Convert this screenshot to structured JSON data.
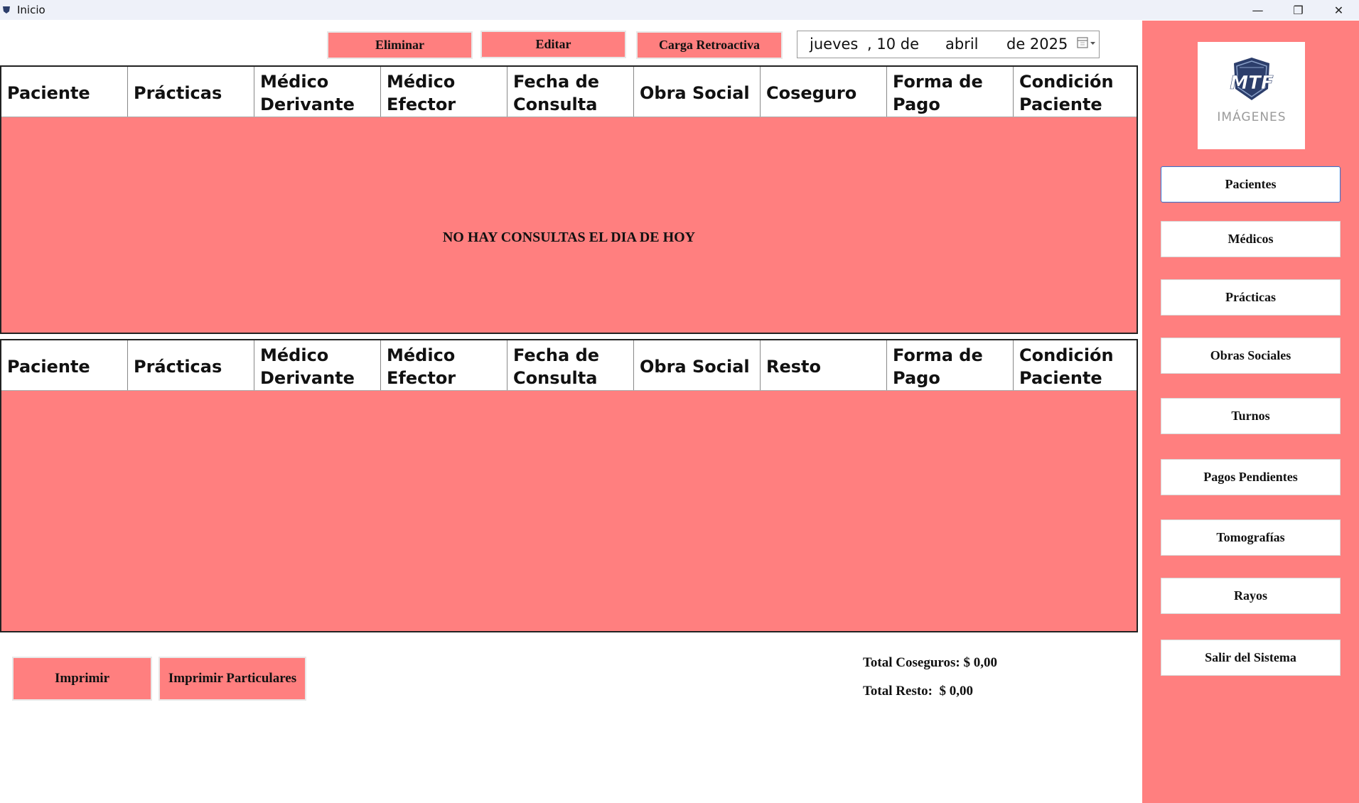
{
  "window": {
    "title": "Inicio",
    "controls": {
      "minimize": "—",
      "maximize": "❐",
      "close": "✕"
    }
  },
  "toolbar": {
    "eliminar_label": "Eliminar",
    "editar_label": "Editar",
    "carga_retroactiva_label": "Carga Retroactiva"
  },
  "date_picker": {
    "weekday": "jueves",
    "day": ", 10 de",
    "month": "abril",
    "year": "de 2025",
    "icon": "calendar-icon"
  },
  "consultas_table": {
    "columns": [
      "Paciente",
      "Prácticas",
      "Médico Derivante",
      "Médico Efector",
      "Fecha de Consulta",
      "Obra Social",
      "Coseguro",
      "Forma de Pago",
      "Condición Paciente"
    ],
    "empty_message": "NO HAY CONSULTAS EL DIA DE HOY",
    "rows": []
  },
  "particulares_table": {
    "columns": [
      "Paciente",
      "Prácticas",
      "Médico Derivante",
      "Médico Efector",
      "Fecha de Consulta",
      "Obra Social",
      "Resto",
      "Forma de Pago",
      "Condición Paciente"
    ],
    "rows": []
  },
  "bottom": {
    "imprimir_label": "Imprimir",
    "imprimir_particulares_label": "Imprimir Particulares",
    "total_coseguros": "Total Coseguros: $ 0,00",
    "total_resto": "Total Resto:  $ 0,00"
  },
  "sidebar": {
    "logo": {
      "brand": "MTF",
      "subtitle": "IMÁGENES"
    },
    "items": [
      {
        "label": "Pacientes",
        "active": true
      },
      {
        "label": "Médicos"
      },
      {
        "label": "Prácticas"
      },
      {
        "label": "Obras Sociales"
      },
      {
        "label": "Turnos"
      },
      {
        "label": "Pagos Pendientes"
      },
      {
        "label": "Tomografías"
      },
      {
        "label": "Rayos"
      },
      {
        "label": "Salir del Sistema"
      }
    ]
  },
  "colors": {
    "accent": "#ff7f7f",
    "logo_navy": "#2c3e6b",
    "active_border": "#2f6fcf"
  }
}
